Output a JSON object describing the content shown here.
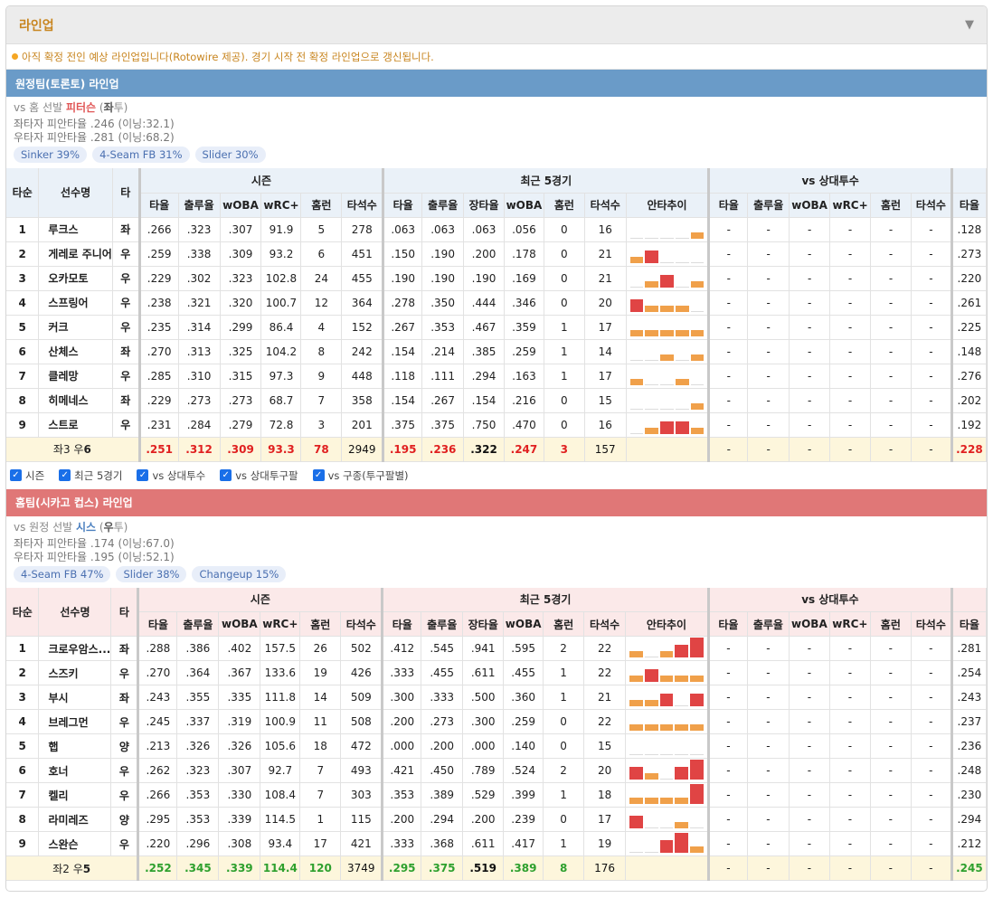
{
  "panel": {
    "title": "라인업",
    "collapse_icon": "triangle-down-icon"
  },
  "notice": "아직 확정 전인 예상 라인업입니다(Rotowire 제공). 경기 시작 전 확정 라인업으로 갱신됩니다.",
  "columns": {
    "groups": [
      "시즌",
      "최근 5경기",
      "vs 상대투수"
    ],
    "fixed": [
      "타순",
      "선수명",
      "타"
    ],
    "season": [
      "타율",
      "출루율",
      "wOBA",
      "wRC+",
      "홈런",
      "타석수"
    ],
    "recent": [
      "타율",
      "출루율",
      "장타율",
      "wOBA",
      "홈런",
      "타석수",
      "안타추이"
    ],
    "vs": [
      "타율",
      "출루율",
      "wOBA",
      "wRC+",
      "홈런",
      "타석수"
    ],
    "extra": "타율"
  },
  "away": {
    "title": "원정팀(토론토) 라인업",
    "vs_prefix": "vs 홈 선발",
    "pitcher": "피터슨",
    "hand_open": "(",
    "hand": "좌",
    "hand_close": "투)",
    "split_left": "좌타자 피안타율 .246 (이닝:32.1)",
    "split_right": "우타자 피안타율 .281 (이닝:68.2)",
    "pitches": [
      "Sinker 39%",
      "4-Seam FB 31%",
      "Slider 30%"
    ],
    "rows": [
      {
        "order": "1",
        "name": "루크스",
        "bat": "좌",
        "s": [
          ".266",
          ".323",
          ".307",
          "91.9",
          "5",
          "278"
        ],
        "r": [
          ".063",
          ".063",
          ".063",
          ".056",
          "0",
          "16"
        ],
        "trend": [
          0,
          0,
          0,
          0,
          1
        ],
        "vs": [
          "-",
          "-",
          "-",
          "-",
          "-",
          "-"
        ],
        "x": ".128"
      },
      {
        "order": "2",
        "name": "게레로 주니어",
        "bat": "우",
        "s": [
          ".259",
          ".338",
          ".309",
          "93.2",
          "6",
          "451"
        ],
        "r": [
          ".150",
          ".190",
          ".200",
          ".178",
          "0",
          "21"
        ],
        "trend": [
          1,
          2,
          0,
          0,
          0
        ],
        "vs": [
          "-",
          "-",
          "-",
          "-",
          "-",
          "-"
        ],
        "x": ".273"
      },
      {
        "order": "3",
        "name": "오카모토",
        "bat": "우",
        "s": [
          ".229",
          ".302",
          ".323",
          "102.8",
          "24",
          "455"
        ],
        "r": [
          ".190",
          ".190",
          ".190",
          ".169",
          "0",
          "21"
        ],
        "trend": [
          0,
          1,
          2,
          0,
          1
        ],
        "vs": [
          "-",
          "-",
          "-",
          "-",
          "-",
          "-"
        ],
        "x": ".220"
      },
      {
        "order": "4",
        "name": "스프링어",
        "bat": "우",
        "s": [
          ".238",
          ".321",
          ".320",
          "100.7",
          "12",
          "364"
        ],
        "r": [
          ".278",
          ".350",
          ".444",
          ".346",
          "0",
          "20"
        ],
        "trend": [
          2,
          1,
          1,
          1,
          0
        ],
        "vs": [
          "-",
          "-",
          "-",
          "-",
          "-",
          "-"
        ],
        "x": ".261"
      },
      {
        "order": "5",
        "name": "커크",
        "bat": "우",
        "s": [
          ".235",
          ".314",
          ".299",
          "86.4",
          "4",
          "152"
        ],
        "r": [
          ".267",
          ".353",
          ".467",
          ".359",
          "1",
          "17"
        ],
        "trend": [
          1,
          1,
          1,
          1,
          1
        ],
        "vs": [
          "-",
          "-",
          "-",
          "-",
          "-",
          "-"
        ],
        "x": ".225"
      },
      {
        "order": "6",
        "name": "산체스",
        "bat": "좌",
        "s": [
          ".270",
          ".313",
          ".325",
          "104.2",
          "8",
          "242"
        ],
        "r": [
          ".154",
          ".214",
          ".385",
          ".259",
          "1",
          "14"
        ],
        "trend": [
          0,
          0,
          1,
          0,
          1
        ],
        "vs": [
          "-",
          "-",
          "-",
          "-",
          "-",
          "-"
        ],
        "x": ".148"
      },
      {
        "order": "7",
        "name": "클레망",
        "bat": "우",
        "s": [
          ".285",
          ".310",
          ".315",
          "97.3",
          "9",
          "448"
        ],
        "r": [
          ".118",
          ".111",
          ".294",
          ".163",
          "1",
          "17"
        ],
        "trend": [
          1,
          0,
          0,
          1,
          0
        ],
        "vs": [
          "-",
          "-",
          "-",
          "-",
          "-",
          "-"
        ],
        "x": ".276"
      },
      {
        "order": "8",
        "name": "히메네스",
        "bat": "좌",
        "s": [
          ".229",
          ".273",
          ".273",
          "68.7",
          "7",
          "358"
        ],
        "r": [
          ".154",
          ".267",
          ".154",
          ".216",
          "0",
          "15"
        ],
        "trend": [
          0,
          0,
          0,
          0,
          1
        ],
        "vs": [
          "-",
          "-",
          "-",
          "-",
          "-",
          "-"
        ],
        "x": ".202"
      },
      {
        "order": "9",
        "name": "스트로",
        "bat": "우",
        "s": [
          ".231",
          ".284",
          ".279",
          "72.8",
          "3",
          "201"
        ],
        "r": [
          ".375",
          ".375",
          ".750",
          ".470",
          "0",
          "16"
        ],
        "trend": [
          0,
          1,
          2,
          2,
          1
        ],
        "vs": [
          "-",
          "-",
          "-",
          "-",
          "-",
          "-"
        ],
        "x": ".192"
      }
    ],
    "total": {
      "label_pre": "좌3 우",
      "label_num": "6",
      "s": [
        ".251",
        ".312",
        ".309",
        "93.3",
        "78",
        "2949"
      ],
      "r": [
        ".195",
        ".236",
        ".322",
        ".247",
        "3",
        "157"
      ],
      "vs": [
        "-",
        "-",
        "-",
        "-",
        "-",
        "-"
      ],
      "x": ".228"
    }
  },
  "checkboxes": [
    "시즌",
    "최근 5경기",
    "vs 상대투수",
    "vs 상대투구팔",
    "vs 구종(투구팔별)"
  ],
  "home": {
    "title": "홈팀(시카고 컵스) 라인업",
    "vs_prefix": "vs 원정 선발",
    "pitcher": "시스",
    "hand_open": "(",
    "hand": "우",
    "hand_close": "투)",
    "split_left": "좌타자 피안타율 .174 (이닝:67.0)",
    "split_right": "우타자 피안타율 .195 (이닝:52.1)",
    "pitches": [
      "4-Seam FB 47%",
      "Slider 38%",
      "Changeup 15%"
    ],
    "rows": [
      {
        "order": "1",
        "name": "크로우암스...",
        "bat": "좌",
        "s": [
          ".288",
          ".386",
          ".402",
          "157.5",
          "26",
          "502"
        ],
        "r": [
          ".412",
          ".545",
          ".941",
          ".595",
          "2",
          "22"
        ],
        "trend": [
          1,
          0,
          1,
          2,
          3
        ],
        "vs": [
          "-",
          "-",
          "-",
          "-",
          "-",
          "-"
        ],
        "x": ".281"
      },
      {
        "order": "2",
        "name": "스즈키",
        "bat": "우",
        "s": [
          ".270",
          ".364",
          ".367",
          "133.6",
          "19",
          "426"
        ],
        "r": [
          ".333",
          ".455",
          ".611",
          ".455",
          "1",
          "22"
        ],
        "trend": [
          1,
          2,
          1,
          1,
          1
        ],
        "vs": [
          "-",
          "-",
          "-",
          "-",
          "-",
          "-"
        ],
        "x": ".254"
      },
      {
        "order": "3",
        "name": "부시",
        "bat": "좌",
        "s": [
          ".243",
          ".355",
          ".335",
          "111.8",
          "14",
          "509"
        ],
        "r": [
          ".300",
          ".333",
          ".500",
          ".360",
          "1",
          "21"
        ],
        "trend": [
          1,
          1,
          2,
          0,
          2
        ],
        "vs": [
          "-",
          "-",
          "-",
          "-",
          "-",
          "-"
        ],
        "x": ".243"
      },
      {
        "order": "4",
        "name": "브레그먼",
        "bat": "우",
        "s": [
          ".245",
          ".337",
          ".319",
          "100.9",
          "11",
          "508"
        ],
        "r": [
          ".200",
          ".273",
          ".300",
          ".259",
          "0",
          "22"
        ],
        "trend": [
          1,
          1,
          1,
          1,
          1
        ],
        "vs": [
          "-",
          "-",
          "-",
          "-",
          "-",
          "-"
        ],
        "x": ".237"
      },
      {
        "order": "5",
        "name": "햅",
        "bat": "양",
        "s": [
          ".213",
          ".326",
          ".326",
          "105.6",
          "18",
          "472"
        ],
        "r": [
          ".000",
          ".200",
          ".000",
          ".140",
          "0",
          "15"
        ],
        "trend": [
          0,
          0,
          0,
          0,
          0
        ],
        "vs": [
          "-",
          "-",
          "-",
          "-",
          "-",
          "-"
        ],
        "x": ".236"
      },
      {
        "order": "6",
        "name": "호너",
        "bat": "우",
        "s": [
          ".262",
          ".323",
          ".307",
          "92.7",
          "7",
          "493"
        ],
        "r": [
          ".421",
          ".450",
          ".789",
          ".524",
          "2",
          "20"
        ],
        "trend": [
          2,
          1,
          0,
          2,
          3
        ],
        "vs": [
          "-",
          "-",
          "-",
          "-",
          "-",
          "-"
        ],
        "x": ".248"
      },
      {
        "order": "7",
        "name": "켈리",
        "bat": "우",
        "s": [
          ".266",
          ".353",
          ".330",
          "108.4",
          "7",
          "303"
        ],
        "r": [
          ".353",
          ".389",
          ".529",
          ".399",
          "1",
          "18"
        ],
        "trend": [
          1,
          1,
          1,
          1,
          3
        ],
        "vs": [
          "-",
          "-",
          "-",
          "-",
          "-",
          "-"
        ],
        "x": ".230"
      },
      {
        "order": "8",
        "name": "라미레즈",
        "bat": "양",
        "s": [
          ".295",
          ".353",
          ".339",
          "114.5",
          "1",
          "115"
        ],
        "r": [
          ".200",
          ".294",
          ".200",
          ".239",
          "0",
          "17"
        ],
        "trend": [
          2,
          0,
          0,
          1,
          0
        ],
        "vs": [
          "-",
          "-",
          "-",
          "-",
          "-",
          "-"
        ],
        "x": ".294"
      },
      {
        "order": "9",
        "name": "스완슨",
        "bat": "우",
        "s": [
          ".220",
          ".296",
          ".308",
          "93.4",
          "17",
          "421"
        ],
        "r": [
          ".333",
          ".368",
          ".611",
          ".417",
          "1",
          "19"
        ],
        "trend": [
          0,
          0,
          2,
          3,
          1
        ],
        "vs": [
          "-",
          "-",
          "-",
          "-",
          "-",
          "-"
        ],
        "x": ".212"
      }
    ],
    "total": {
      "label_pre": "좌2 우",
      "label_num": "5",
      "s": [
        ".252",
        ".345",
        ".339",
        "114.4",
        "120",
        "3749"
      ],
      "r": [
        ".295",
        ".375",
        ".519",
        ".389",
        "8",
        "176"
      ],
      "vs": [
        "-",
        "-",
        "-",
        "-",
        "-",
        "-"
      ],
      "x": ".245"
    }
  }
}
